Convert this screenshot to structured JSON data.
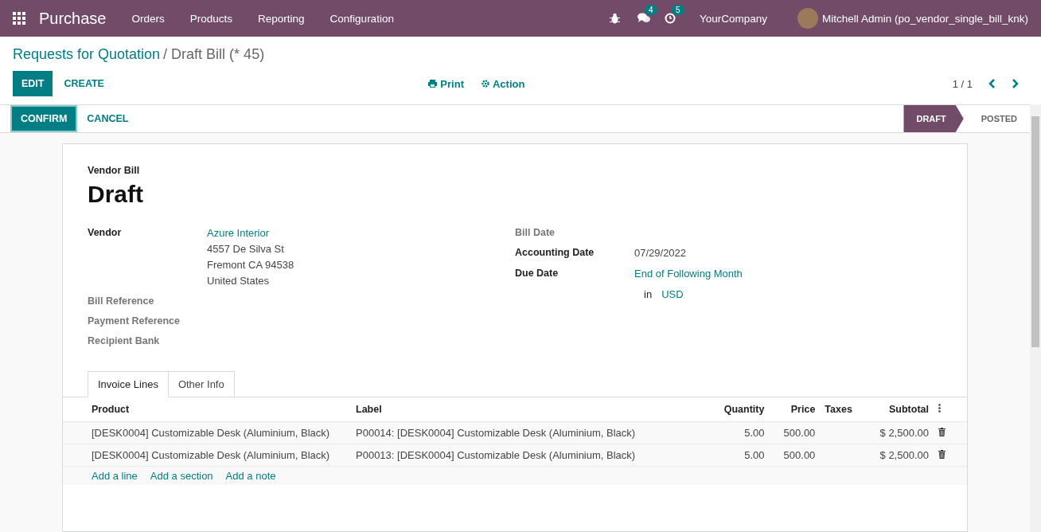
{
  "navbar": {
    "app_name": "Purchase",
    "menu": [
      "Orders",
      "Products",
      "Reporting",
      "Configuration"
    ],
    "messages_count": "4",
    "activities_count": "5",
    "company": "YourCompany",
    "user": "Mitchell Admin (po_vendor_single_bill_knk)"
  },
  "breadcrumb": {
    "parent": "Requests for Quotation",
    "current": "/ Draft Bill (* 45)"
  },
  "control_panel": {
    "buttons": [
      "EDIT",
      "CREATE"
    ],
    "actions": [
      "Print",
      "Action"
    ],
    "pager": "1 / 1"
  },
  "status_bar": {
    "buttons": [
      "CONFIRM",
      "CANCEL"
    ],
    "stages": [
      {
        "label": "DRAFT",
        "selected": true
      },
      {
        "label": "POSTED",
        "selected": false
      }
    ]
  },
  "sheet": {
    "subtitle": "Vendor Bill",
    "title": "Draft",
    "left_fields": [
      {
        "label": "Vendor",
        "required": true,
        "link": "Azure Interior",
        "lines": [
          "4557 De Silva St",
          "Fremont CA 94538",
          "United States"
        ]
      },
      {
        "label": "Bill Reference",
        "required": false
      },
      {
        "label": "Payment Reference",
        "required": false
      },
      {
        "label": "Recipient Bank",
        "required": false
      }
    ],
    "right_fields": [
      {
        "label": "Bill Date",
        "required": false
      },
      {
        "label": "Accounting Date",
        "required": true,
        "value": "07/29/2022"
      },
      {
        "label": "Due Date",
        "required": true,
        "link": "End of Following Month"
      }
    ],
    "currency": {
      "prefix": "in",
      "link": "USD"
    },
    "tabs": [
      {
        "label": "Invoice Lines",
        "selected": true
      },
      {
        "label": "Other Info",
        "selected": false
      }
    ],
    "table": {
      "columns": [
        "Product",
        "Label",
        "Quantity",
        "Price",
        "Taxes",
        "Subtotal"
      ],
      "rows": [
        {
          "product": "[DESK0004] Customizable Desk (Aluminium, Black)",
          "label": "P00014: [DESK0004] Customizable Desk (Aluminium, Black)",
          "quantity": "5.00",
          "price": "500.00",
          "subtotal": "$ 2,500.00"
        },
        {
          "product": "[DESK0004] Customizable Desk (Aluminium, Black)",
          "label": "P00013: [DESK0004] Customizable Desk (Aluminium, Black)",
          "quantity": "5.00",
          "price": "500.00",
          "subtotal": "$ 2,500.00"
        }
      ],
      "add_links": [
        "Add a line",
        "Add a section",
        "Add a note"
      ]
    }
  }
}
